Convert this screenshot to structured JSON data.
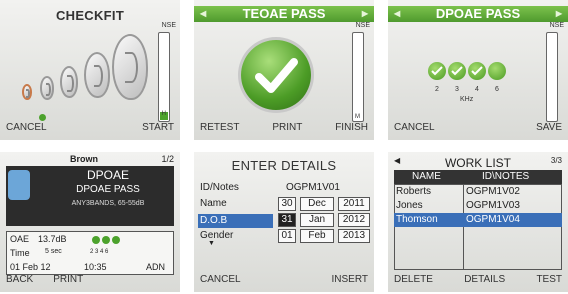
{
  "screen1": {
    "title": "CHECKFIT",
    "meter_top": "NSE",
    "meter_bottom": "H",
    "softkeys": {
      "left": "CANCEL",
      "right": "START"
    }
  },
  "screen2": {
    "title": "TEOAE PASS",
    "meter_top": "NSE",
    "meter_bottom": "M",
    "softkeys": {
      "left": "RETEST",
      "center": "PRINT",
      "right": "FINISH"
    }
  },
  "screen3": {
    "title": "DPOAE PASS",
    "meter_top": "NSE",
    "frequencies": [
      "2",
      "3",
      "4",
      "6"
    ],
    "unit": "KHz",
    "softkeys": {
      "left": "CANCEL",
      "right": "SAVE"
    }
  },
  "screen4": {
    "name": "Brown",
    "page": "1/2",
    "title1": "DPOAE",
    "title2": "DPOAE PASS",
    "title3": "ANY3BANDS, 65-55dB",
    "oae_label": "OAE",
    "oae_value": "13.7dB",
    "time_label": "Time",
    "time_value": "5 sec",
    "dot_freqs": "2 3 4 6",
    "date": "01 Feb 12",
    "clock": "10:35",
    "tag": "ADN",
    "softkeys": {
      "left": "BACK",
      "center": "PRINT"
    }
  },
  "screen5": {
    "title": "ENTER DETAILS",
    "id_label": "ID/Notes",
    "id_value": "OGPM1V01",
    "name_label": "Name",
    "dob_label": "D.O.B",
    "gender_label": "Gender",
    "days": [
      "30",
      "31",
      "01"
    ],
    "months": [
      "Dec",
      "Jan",
      "Feb"
    ],
    "years": [
      "2011",
      "2012",
      "2013"
    ],
    "softkeys": {
      "left": "CANCEL",
      "right": "INSERT"
    }
  },
  "screen6": {
    "title": "WORK LIST",
    "page": "3/3",
    "col_name": "NAME",
    "col_notes": "ID\\NOTES",
    "rows": [
      {
        "name": "Roberts",
        "notes": "OGPM1V02"
      },
      {
        "name": "Jones",
        "notes": "OGPM1V03"
      },
      {
        "name": "Thomson",
        "notes": "OGPM1V04"
      }
    ],
    "softkeys": {
      "left": "DELETE",
      "center": "DETAILS",
      "right": "TEST"
    }
  }
}
